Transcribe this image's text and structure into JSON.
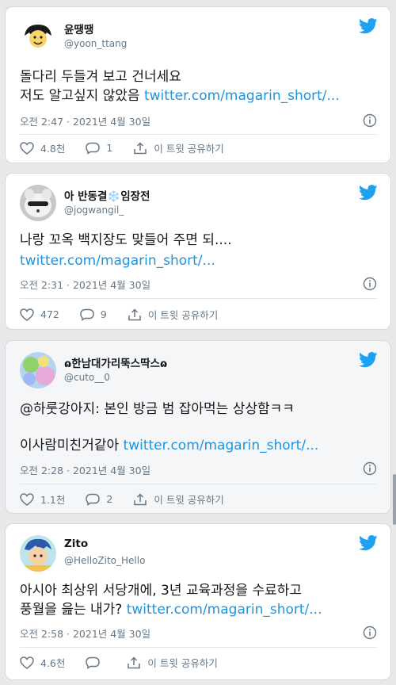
{
  "tweets": [
    {
      "name": "윤땡땡",
      "handle": "@yoon_ttang",
      "line1": "돌다리 두들겨 보고 건너세요",
      "line2": "저도 알고싶지 않았음",
      "link": "twitter.com/magarin_short/...",
      "timestamp": "오전 2:47 · 2021년 4월 30일",
      "likes": "4.8천",
      "replies": "1",
      "share": "이 트윗 공유하기"
    },
    {
      "name": "아 반동결❄️임장전",
      "handle": "@jogwangil_",
      "line1": "나랑 꼬옥 백지장도 맞들어 주면 되....",
      "link": "twitter.com/magarin_short/...",
      "timestamp": "오전 2:31 · 2021년 4월 30일",
      "likes": "472",
      "replies": "9",
      "share": "이 트윗 공유하기"
    },
    {
      "name": "ɷ한남대가리뚝스딱스ɷ",
      "handle": "@cuto__0",
      "line1": "@하룻강아지: 본인 방금 범 잡아먹는 상상함ㅋㅋ",
      "line2": "이사람미친거같아",
      "link": "twitter.com/magarin_short/...",
      "timestamp": "오전 2:28 · 2021년 4월 30일",
      "likes": "1.1천",
      "replies": "2",
      "share": "이 트윗 공유하기"
    },
    {
      "name": "Zito",
      "handle": "@HelloZito_Hello",
      "line1": "아시아 최상위 서당개에, 3년 교육과정을 수료하고",
      "line2": "풍월을 읊는 내가?",
      "link": "twitter.com/magarin_short/...",
      "timestamp": "오전 2:58 · 2021년 4월 30일",
      "likes": "4.6천",
      "replies": "",
      "share": "이 트윗 공유하기"
    }
  ],
  "colors": {
    "link": "#1b95e0",
    "bird": "#1da1f2",
    "muted": "#657786"
  },
  "icons": [
    "twitter-bird-icon",
    "info-icon",
    "heart-icon",
    "reply-icon",
    "share-icon"
  ]
}
